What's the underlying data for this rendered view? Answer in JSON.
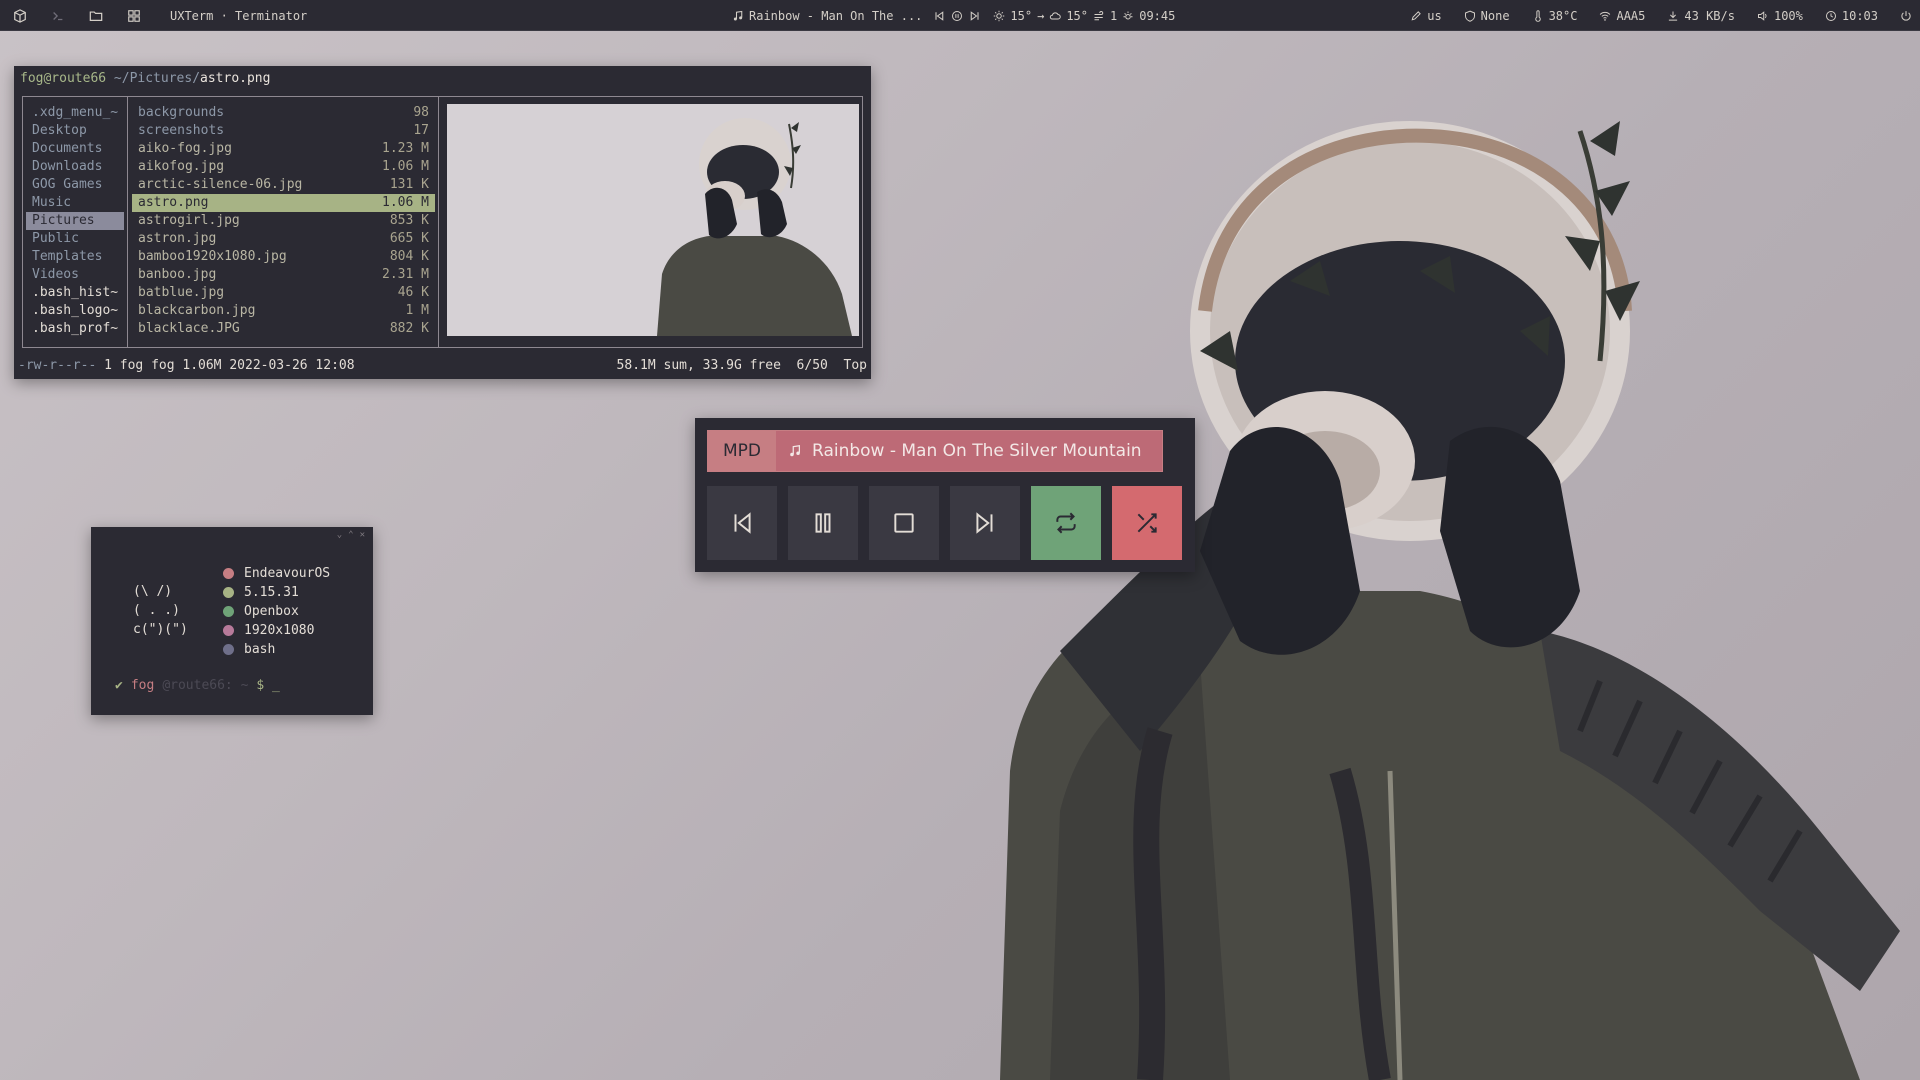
{
  "topbar": {
    "window_title": "UXTerm · Terminator",
    "now_playing": "Rainbow - Man On The ...",
    "weather_temp": "15°",
    "weather_arrow": "→",
    "weather_cloud_temp": "15°",
    "weather_wind": "1",
    "sun_time": "09:45",
    "keyboard_layout": "us",
    "vpn": "None",
    "cpu_temp": "38°C",
    "wifi": "AAA5",
    "download_speed": "43 KB/s",
    "volume": "100%",
    "clock": "10:03"
  },
  "ranger": {
    "host": "fog@route66",
    "dir": "~/Pictures/",
    "file": "astro.png",
    "parent_items": [
      {
        "name": ".xdg_menu_~",
        "type": "dir"
      },
      {
        "name": "Desktop",
        "type": "dir"
      },
      {
        "name": "Documents",
        "type": "dir"
      },
      {
        "name": "Downloads",
        "type": "dir"
      },
      {
        "name": "GOG Games",
        "type": "dir"
      },
      {
        "name": "Music",
        "type": "dir"
      },
      {
        "name": "Pictures",
        "type": "dir",
        "selected": true
      },
      {
        "name": "Public",
        "type": "dir"
      },
      {
        "name": "Templates",
        "type": "dir"
      },
      {
        "name": "Videos",
        "type": "dir"
      },
      {
        "name": ".bash_hist~",
        "type": "file"
      },
      {
        "name": ".bash_logo~",
        "type": "file"
      },
      {
        "name": ".bash_prof~",
        "type": "file"
      }
    ],
    "files": [
      {
        "name": "backgrounds",
        "size": "98",
        "type": "dir"
      },
      {
        "name": "screenshots",
        "size": "17",
        "type": "dir"
      },
      {
        "name": "aiko-fog.jpg",
        "size": "1.23 M"
      },
      {
        "name": "aikofog.jpg",
        "size": "1.06 M"
      },
      {
        "name": "arctic-silence-06.jpg",
        "size": "131 K"
      },
      {
        "name": "astro.png",
        "size": "1.06 M",
        "selected": true
      },
      {
        "name": "astrogirl.jpg",
        "size": "853 K"
      },
      {
        "name": "astron.jpg",
        "size": "665 K"
      },
      {
        "name": "bamboo1920x1080.jpg",
        "size": "804 K"
      },
      {
        "name": "banboo.jpg",
        "size": "2.31 M"
      },
      {
        "name": "batblue.jpg",
        "size": "46 K"
      },
      {
        "name": "blackcarbon.jpg",
        "size": "1 M"
      },
      {
        "name": "blacklace.JPG",
        "size": "882 K"
      }
    ],
    "status_perm": "-rw-r--r--",
    "status_info": "1 fog fog 1.06M 2022-03-26 12:08",
    "status_right": "58.1M sum, 33.9G free  6/50  Top"
  },
  "mpd": {
    "label": "MPD",
    "song": "Rainbow - Man On The Silver Mountain",
    "buttons": [
      "previous",
      "pause",
      "stop",
      "next",
      "repeat",
      "random"
    ],
    "colors": {
      "repeat": "#6fa378",
      "random": "#d46a6f",
      "accent": "#c67e83"
    }
  },
  "fetch": {
    "ascii": [
      "(\\ /)",
      "( . .)",
      "c(\")(\")"
    ],
    "info": [
      {
        "value": "EndeavourOS",
        "color": "#c67e83"
      },
      {
        "value": "5.15.31",
        "color": "#a7b385"
      },
      {
        "value": "Openbox",
        "color": "#6fa378"
      },
      {
        "value": "1920x1080",
        "color": "#b77a9a"
      },
      {
        "value": "bash",
        "color": "#6f6f8a"
      }
    ],
    "prompt_ok": "✔",
    "prompt_user": "fog",
    "prompt_host": "@route66: ~",
    "prompt_symbol": "$ _"
  }
}
